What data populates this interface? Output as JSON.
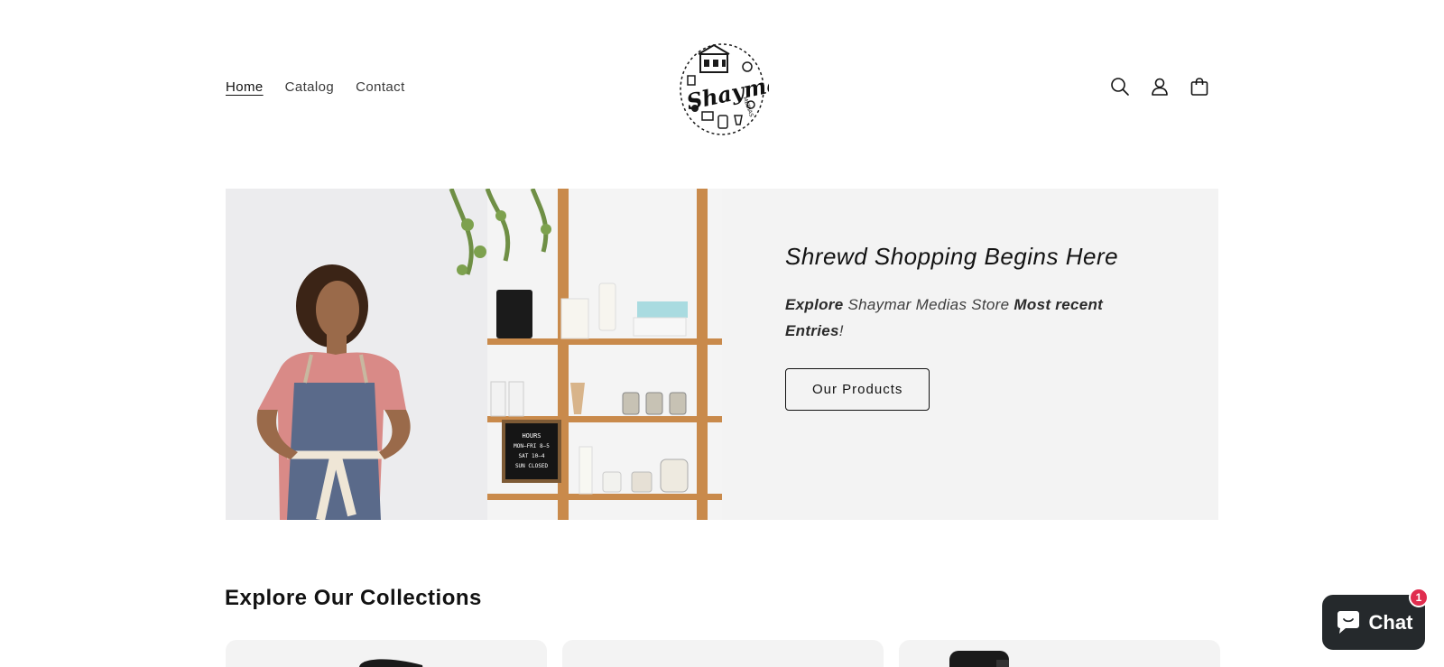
{
  "header": {
    "nav": [
      {
        "label": "Home"
      },
      {
        "label": "Catalog"
      },
      {
        "label": "Contact"
      }
    ],
    "logo": {
      "text": "Shaymar",
      "subtext": "MEDIAS"
    },
    "icons": [
      "search-icon",
      "account-icon",
      "cart-icon"
    ]
  },
  "hero": {
    "heading": "Shrewd Shopping Begins Here",
    "subtitle_bold_1": "Explore",
    "subtitle_plain_1": " Shaymar Medias Store ",
    "subtitle_bold_2": "Most recent Entries",
    "subtitle_plain_2": "!",
    "button_label": "Our Products",
    "sign_lines": [
      "HOURS",
      "MON—FRI 8—5",
      "SAT 10—4",
      "SUN CLOSED"
    ]
  },
  "collections": {
    "title": "Explore Our Collections"
  },
  "chat": {
    "label": "Chat",
    "badge_count": "1"
  },
  "colors": {
    "text": "#121212",
    "hero_panel": "#f3f3f3",
    "chat_bg": "#25292c",
    "badge": "#e02d4f"
  }
}
